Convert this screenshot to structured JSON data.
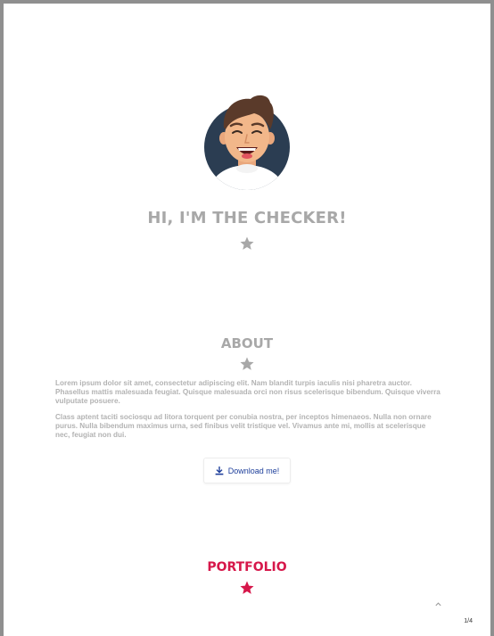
{
  "hero": {
    "title": "HI, I'M THE CHECKER!",
    "icons": [
      "avatar-illustration",
      "star-icon"
    ]
  },
  "about": {
    "title": "ABOUT",
    "paragraphs": [
      "Lorem ipsum dolor sit amet, consectetur adipiscing elit. Nam blandit turpis iaculis nisi pharetra auctor. Phasellus mattis malesuada feugiat. Quisque malesuada orci non risus scelerisque bibendum. Quisque viverra vulputate posuere.",
      "Class aptent taciti sociosqu ad litora torquent per conubia nostra, per inceptos himenaeos. Nulla non ornare purus. Nulla bibendum maximus urna, sed finibus velit tristique vel. Vivamus ante mi, mollis at scelerisque nec, feugiat non dui."
    ],
    "download_label": "Download me!",
    "download_icon": "download-icon"
  },
  "portfolio": {
    "title": "PORTFOLIO",
    "icon": "star-icon"
  },
  "footer": {
    "scroll_icon": "chevron-up-icon",
    "page_indicator": "1/4"
  },
  "colors": {
    "heading_gray": "#a8a8a8",
    "text_gray": "#b3b3b3",
    "accent_red": "#d6174a",
    "link_blue": "#1d3e9a",
    "avatar_bg": "#2b3d52"
  }
}
